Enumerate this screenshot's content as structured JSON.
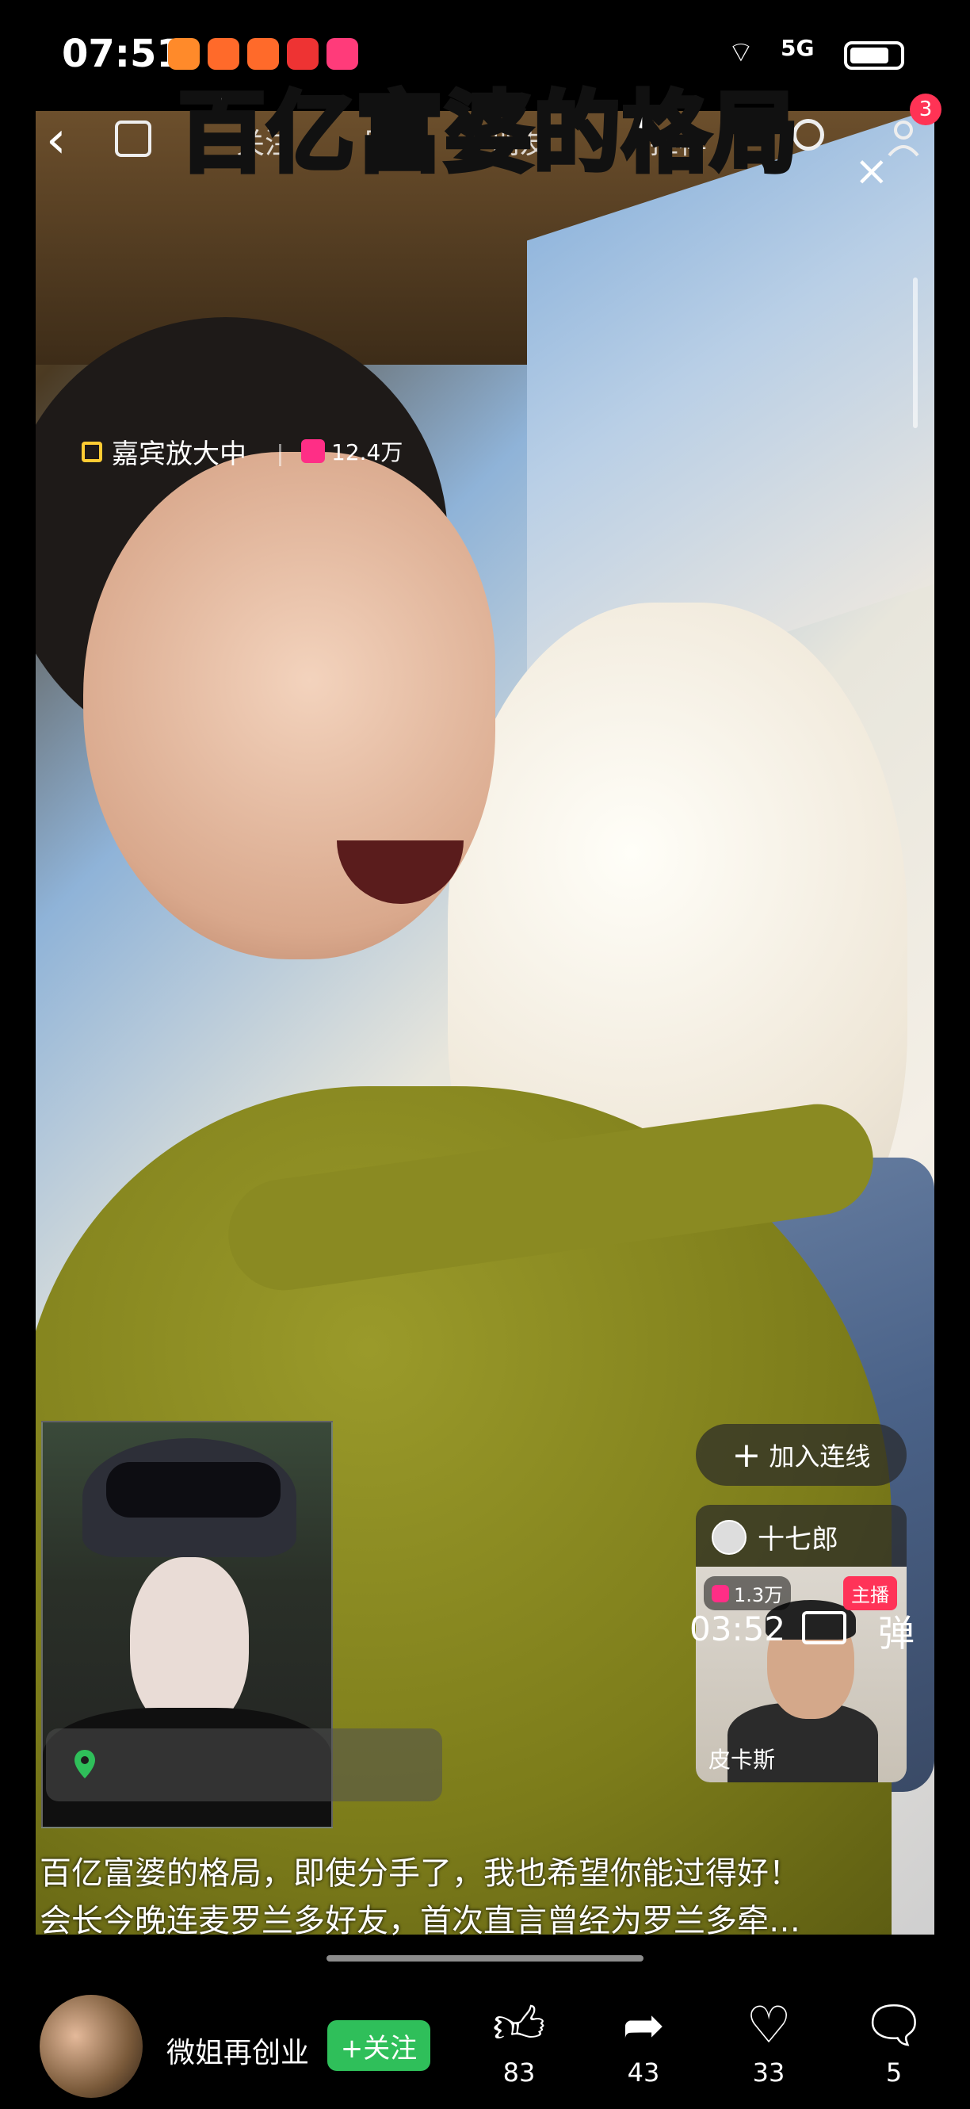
{
  "status_bar": {
    "time": "07:51",
    "network": "5G"
  },
  "overlay_title": "百亿富婆的格局",
  "top_nav": {
    "tabs": [
      "关注",
      "同城",
      "朋友",
      "推荐"
    ],
    "notification_count": "3"
  },
  "guest_panel": {
    "label": "嘉宾放大中",
    "viewer_count": "12.4万"
  },
  "join_button": {
    "label": "加入连线"
  },
  "anchor_card": {
    "name": "十七郎",
    "count": "1.3万",
    "tag": "主播",
    "host_label": "皮卡斯"
  },
  "video_controls": {
    "timer": "03:52",
    "danmu_label": "弹"
  },
  "caption": {
    "line1": "百亿富婆的格局，即使分手了，我也希望你能过得好！",
    "line2": "会长今晚连麦罗兰多好友，首次直言曾经为罗兰多牵…"
  },
  "bottom_bar": {
    "author_name": "微姐再创业",
    "follow_label": "+关注",
    "actions": [
      {
        "icon": "thumbs-up-icon",
        "count": "83"
      },
      {
        "icon": "share-icon",
        "count": "43"
      },
      {
        "icon": "heart-icon",
        "count": "33"
      },
      {
        "icon": "comment-icon",
        "count": "5"
      }
    ]
  }
}
